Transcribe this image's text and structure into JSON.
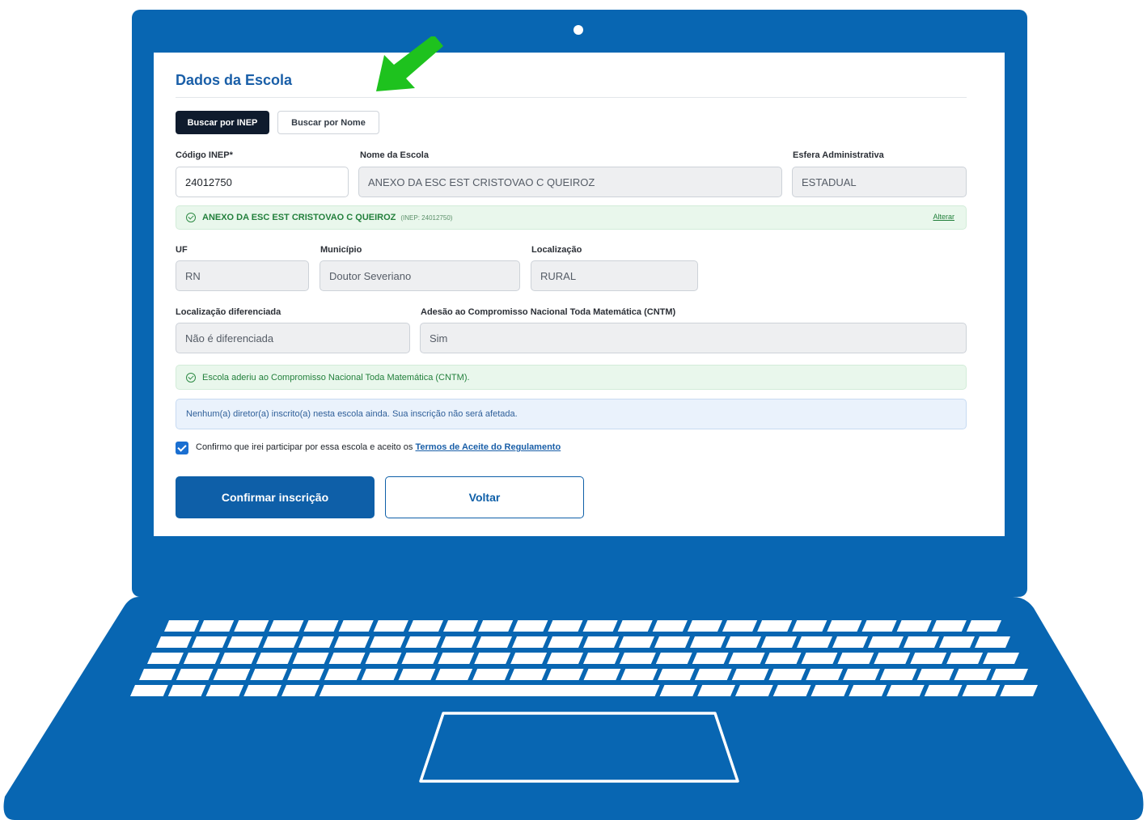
{
  "form": {
    "section_title": "Dados da Escola",
    "tabs": {
      "by_inep": "Buscar por INEP",
      "by_name": "Buscar por Nome"
    },
    "fields": {
      "inep_label": "Código INEP*",
      "inep_value": "24012750",
      "school_name_label": "Nome da Escola",
      "school_name_value": "ANEXO DA ESC EST CRISTOVAO C QUEIROZ",
      "admin_sphere_label": "Esfera Administrativa",
      "admin_sphere_value": "ESTADUAL",
      "uf_label": "UF",
      "uf_value": "RN",
      "municipality_label": "Município",
      "municipality_value": "Doutor Severiano",
      "location_label": "Localização",
      "location_value": "RURAL",
      "diff_location_label": "Localização diferenciada",
      "diff_location_value": "Não é diferenciada",
      "cntm_label": "Adesão ao Compromisso Nacional Toda Matemática (CNTM)",
      "cntm_value": "Sim"
    },
    "selected_school": {
      "name": "ANEXO DA ESC EST CRISTOVAO C QUEIROZ",
      "inep_tag": "(INEP: 24012750)",
      "change_link": "Alterar"
    },
    "cntm_notice": "Escola aderiu ao Compromisso Nacional Toda Matemática (CNTM).",
    "director_notice": "Nenhum(a) diretor(a) inscrito(a) nesta escola ainda. Sua inscrição não será afetada.",
    "consent": {
      "text": "Confirmo que irei participar por essa escola e aceito os",
      "link": "Termos de Aceite do Regulamento",
      "checked": true
    },
    "buttons": {
      "confirm": "Confirmar inscrição",
      "back": "Voltar"
    }
  },
  "colors": {
    "laptop_body": "#0866b2",
    "accent_blue": "#0e5fa8",
    "success_green": "#23803c",
    "arrow_green": "#1ec21e"
  }
}
